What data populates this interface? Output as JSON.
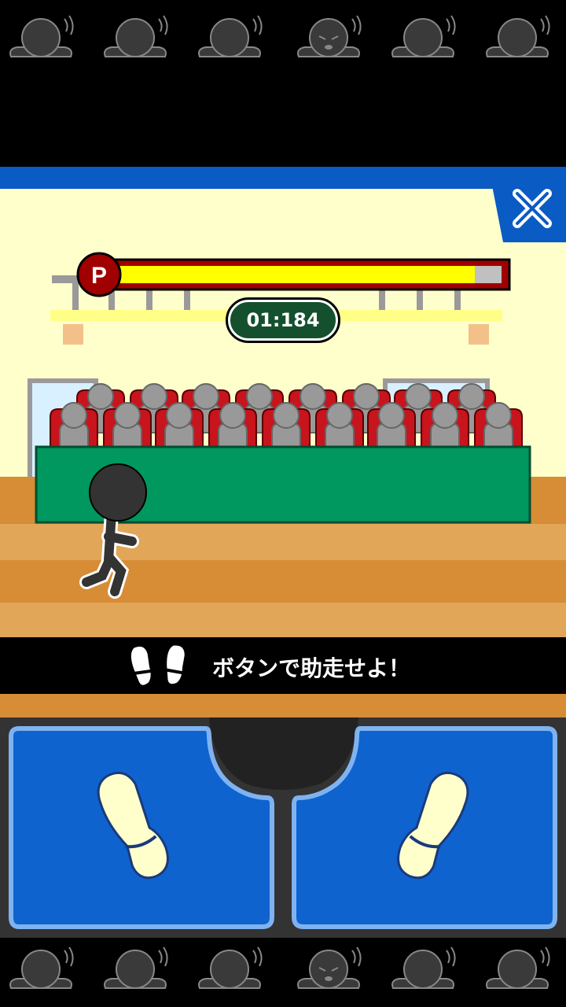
{
  "hud": {
    "power_label": "P",
    "power_level": 0.93,
    "timer": "01:184"
  },
  "instruction": {
    "text": "ボタンで助走せよ！"
  },
  "colors": {
    "sky_blue": "#0a5bc4",
    "wall": "#ffffcc",
    "table_green": "#00985f",
    "floor": "#e2a659",
    "button_blue": "#0f63cf",
    "power_fill": "#ffff00"
  }
}
